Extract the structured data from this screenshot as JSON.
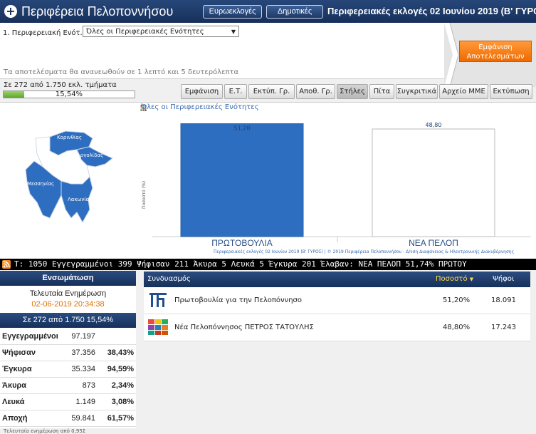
{
  "header": {
    "title": "Περιφέρεια Πελοποννήσου",
    "btn_euro": "Ευρωεκλογές",
    "btn_dimo": "Δημοτικές",
    "election_title": "Περιφερειακές εκλογές 02 Ιουνίου 2019 (Β' ΓΥΡΟΣ)"
  },
  "filter": {
    "label": "1. Περιφερειακή Ενότ.:",
    "selected": "Όλες οι Περιφερειακές Ενότητες",
    "refresh_note": "Τα αποτελέσματα θα ανανεωθούν σε 1 λεπτό και 5 δευτερόλεπτα",
    "show_results_line1": "Εμφάνιση",
    "show_results_line2": "Αποτελεσμάτων"
  },
  "progress": {
    "text": "Σε 272 από 1.750 εκλ. τμήματα",
    "percent_label": "15,54%",
    "fraction": 0.1554
  },
  "toolbar": {
    "buttons": [
      "Εμφάνιση",
      "Ε.Τ.",
      "Εκτύπ. Γρ.",
      "Αποθ. Γρ.",
      "Στήλες",
      "Πίτα",
      "Συγκριτικά",
      "Αρχείο ΜΜΕ",
      "Εκτύπωση"
    ],
    "active": "Στήλες"
  },
  "map": {
    "labels": [
      "Κορινθίας",
      "Αργολίδας",
      "Μεσσηνίας",
      "Λακωνίας",
      "Αρκαδίας"
    ],
    "colors": {
      "region": "#2e6ec0",
      "selected": "#ffffff",
      "outline": "#cfd8e6"
    }
  },
  "chart_data": {
    "type": "bar",
    "title": "Όλες οι Περιφερειακές Ενότητες",
    "ylabel": "Ποσοστό (%)",
    "categories": [
      "ΠΡΩΤΟΒΟΥΛΙΑ",
      "ΝΕΑ ΠΕΛΟΠ"
    ],
    "values": [
      51.2,
      48.8
    ],
    "value_labels": [
      "51,20",
      "48,80"
    ],
    "colors": [
      "#2e6ec0",
      "#ffffff"
    ],
    "ylim": [
      0,
      53
    ],
    "caption": "Περιφερειακές εκλογές 02 Ιουνίου 2019 (Β' ΓΥΡΟΣ) | © 2019 Περιφέρεια Πελοποννήσου - Δ/νση Διαφάνειας & Ηλεκτρονικής Διακυβέρνησης"
  },
  "ticker": {
    "text": "Τ: 1050  Εγγεγραμμένοι 399  Ψήφισαν 211  Άκυρα 5  Λευκά 5  Έγκυρα 201  Έλαβαν: ΝΕΑ ΠΕΛΟΠ 51,74%  ΠΡΩΤΟΥ"
  },
  "summary": {
    "header": "Ενσωμάτωση",
    "last_update_label": "Τελευταία Ενημέρωση",
    "last_update": "02-06-2019 20:34:38",
    "count_line": "Σε 272 από  1.750   15,54%",
    "rows": [
      {
        "label": "Εγγεγραμμένοι",
        "value": "97.197",
        "pct": ""
      },
      {
        "label": "Ψήφισαν",
        "value": "37.356",
        "pct": "38,43%"
      },
      {
        "label": "Έγκυρα",
        "value": "35.334",
        "pct": "94,59%"
      },
      {
        "label": "Άκυρα",
        "value": "873",
        "pct": "2,34%"
      },
      {
        "label": "Λευκά",
        "value": "1.149",
        "pct": "3,08%"
      },
      {
        "label": "Αποχή",
        "value": "59.841",
        "pct": "61,57%"
      }
    ]
  },
  "results": {
    "headers": {
      "coalition": "Συνδυασμός",
      "percent": "Ποσοστό",
      "votes": "Ψήφοι"
    },
    "rows": [
      {
        "name": "Πρωτοβουλία για την Πελοπόννησο",
        "percent": "51,20%",
        "votes": "18.091",
        "logo": "protovoulia-logo"
      },
      {
        "name": "Νέα Πελοπόννησος ΠΕΤΡΟΣ ΤΑΤΟΥΛΗΣ",
        "percent": "48,80%",
        "votes": "17.243",
        "logo": "nea-peloponnisos-logo"
      }
    ]
  },
  "footer": {
    "note": "Τελευταία ενημέρωση από 0,95Σ"
  }
}
